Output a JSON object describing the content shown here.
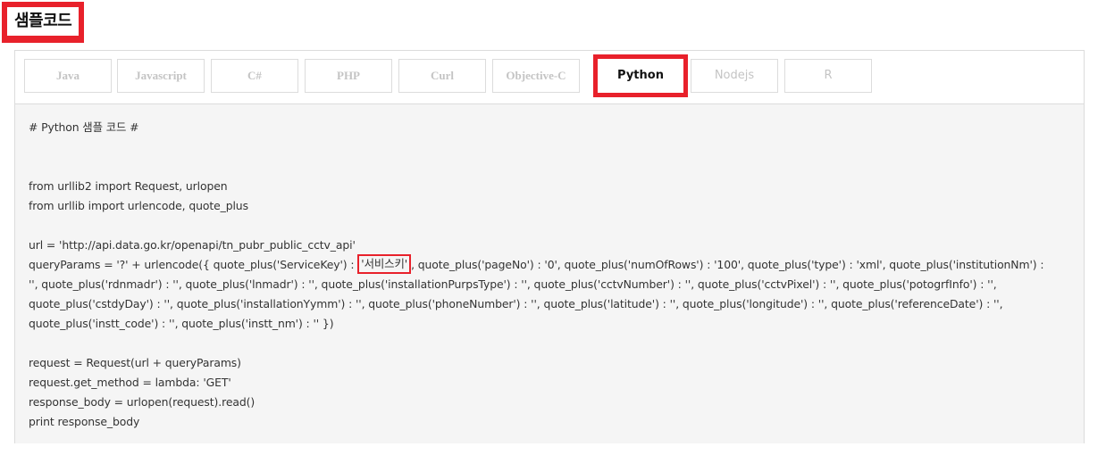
{
  "section_title": "샘플코드",
  "tabs": [
    {
      "label": "Java",
      "active": false
    },
    {
      "label": "Javascript",
      "active": false
    },
    {
      "label": "C#",
      "active": false
    },
    {
      "label": "PHP",
      "active": false
    },
    {
      "label": "Curl",
      "active": false
    },
    {
      "label": "Objective-C",
      "active": false
    },
    {
      "label": "Python",
      "active": true
    },
    {
      "label": "Nodejs",
      "active": false
    },
    {
      "label": "R",
      "active": false
    }
  ],
  "code": {
    "comment": "# Python 샘플 코드 #",
    "import1": "from urllib2 import Request, urlopen",
    "import2": "from urllib import urlencode, quote_plus",
    "url_line": "url = 'http://api.data.go.kr/openapi/tn_pubr_public_cctv_api'",
    "query_prefix": "queryParams = '?' + urlencode({ quote_plus('ServiceKey') : ",
    "service_key": "'서비스키'",
    "query_rest1": ", quote_plus('pageNo') : '0', quote_plus('numOfRows') : '100', quote_plus('type') : 'xml', quote_plus('institutionNm') :",
    "query_line2": "'', quote_plus('rdnmadr') : '', quote_plus('lnmadr') : '', quote_plus('installationPurpsType') : '', quote_plus('cctvNumber') : '', quote_plus('cctvPixel') : '', quote_plus('potogrfInfo') : '',",
    "query_line3": "quote_plus('cstdyDay') : '', quote_plus('installationYymm') : '', quote_plus('phoneNumber') : '', quote_plus('latitude') : '', quote_plus('longitude') : '', quote_plus('referenceDate') : '',",
    "query_line4": "quote_plus('instt_code') : '', quote_plus('instt_nm') : '' })",
    "request_line": "request = Request(url + queryParams)",
    "method_line": "request.get_method = lambda: 'GET'",
    "response_line": "response_body = urlopen(request).read()",
    "print_line": "print response_body"
  },
  "colors": {
    "highlight": "#e8212b",
    "code_bg": "#f5f5f5",
    "tab_inactive_text": "#c4c4c4"
  }
}
